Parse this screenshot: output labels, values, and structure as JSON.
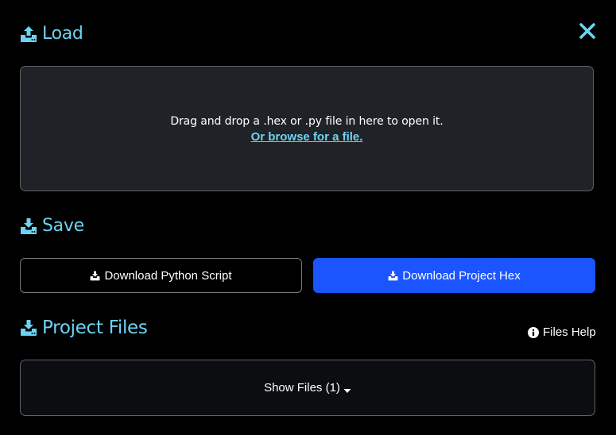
{
  "load": {
    "title": "Load",
    "icon": "upload-icon",
    "drop_text": "Drag and drop a .hex or .py file in here to open it.",
    "browse_label": "Or browse for a file."
  },
  "close": {
    "icon": "close-icon"
  },
  "save": {
    "title": "Save",
    "icon": "download-icon",
    "download_python_label": "Download Python Script",
    "download_hex_label": "Download Project Hex"
  },
  "project_files": {
    "title": "Project Files",
    "icon": "download-icon",
    "help_label": "Files Help",
    "help_icon": "info-icon",
    "show_files_label": "Show Files (1)",
    "toggle_icon": "caret-down-icon"
  },
  "colors": {
    "accent": "#6cd3f2",
    "primary_button": "#1a55ff",
    "background": "#000000",
    "drop_zone_bg": "#1f2226",
    "border": "#5e6268"
  }
}
